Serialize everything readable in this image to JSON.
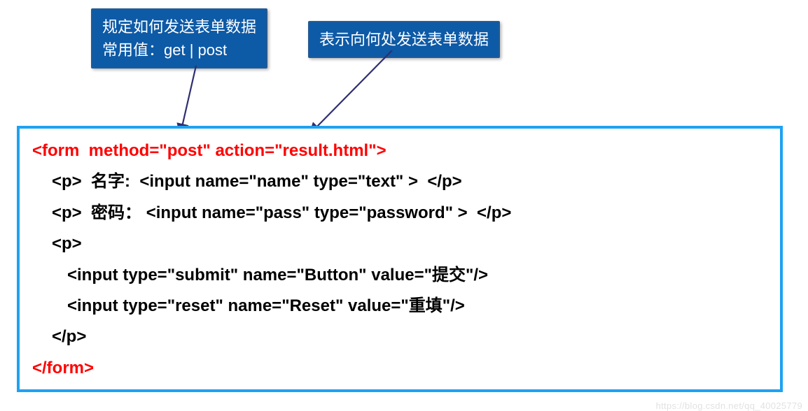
{
  "callouts": {
    "method": {
      "line1": "规定如何发送表单数据",
      "line2": "常用值：get  | post"
    },
    "action": "表示向何处发送表单数据"
  },
  "code": {
    "form_open": "<form  method=\"post\" action=\"result.html\">",
    "line_name": "<p>  名字:  <input name=\"name\" type=\"text\" >  </p>",
    "line_pass": "<p>  密码： <input name=\"pass\" type=\"password\" >  </p>",
    "p_open": "<p>",
    "line_submit": "<input type=\"submit\" name=\"Button\" value=\"提交\"/>",
    "line_reset": "<input type=\"reset\" name=\"Reset\" value=\"重填\"/>",
    "p_close": "</p>",
    "form_close": "</form>"
  },
  "watermark": "https://blog.csdn.net/qq_40025779"
}
